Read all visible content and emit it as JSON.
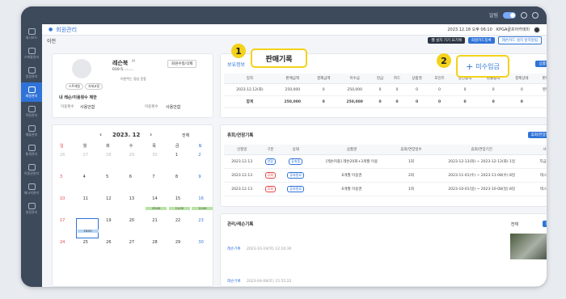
{
  "app": {
    "logo": "",
    "top_status": "알림"
  },
  "header": {
    "title": "회원관리",
    "datetime": "2023.12.18 오후 06:10",
    "center": "KPGA골프아카데미"
  },
  "subheader": {
    "back": "이전",
    "btn_1": "웹 설치 기기 요기에",
    "btn_2": "회원카드등록",
    "btn_3": "레슨카드 설치 방지알림"
  },
  "sidebar": {
    "items": [
      {
        "label": "대시보드"
      },
      {
        "label": "스케줄관리"
      },
      {
        "label": "일정관리"
      },
      {
        "label": "회원관리"
      },
      {
        "label": "직원관리"
      },
      {
        "label": "매출관리"
      },
      {
        "label": "통계관리"
      },
      {
        "label": "이용권관리"
      },
      {
        "label": "메시지관리"
      },
      {
        "label": "설정관리"
      }
    ]
  },
  "profile": {
    "name": "레슨북",
    "tag": "M",
    "phone": "010-5...-.....",
    "btn_register": "회원수정/삭제",
    "memo": "이번주는 정상 운동",
    "badge_1": "스트레칭",
    "badge_2": "자세교정",
    "section_title": "내 레슨/이용횟수 제한",
    "field_1_label": "이용횟수",
    "field_1_value": "사용안함",
    "field_2_label": "이용횟수",
    "field_2_value": "사용안함"
  },
  "sales": {
    "tab": "보유정보",
    "add_btn": "상품등록",
    "columns": [
      "일자",
      "판매금액",
      "결제금액",
      "미수금",
      "현금",
      "카드",
      "상품권",
      "포인트",
      "할인금액",
      "환불금액",
      "결제상태",
      "판매자"
    ],
    "rows": [
      [
        "2023.12.12(화)",
        "250,000",
        "0",
        "250,000",
        "0",
        "0",
        "0",
        "0",
        "0",
        "0",
        "0",
        "영업주"
      ],
      [
        "합계",
        "250,000",
        "0",
        "250,000",
        "0",
        "0",
        "0",
        "0",
        "0",
        "0",
        "0",
        ""
      ]
    ]
  },
  "callouts": {
    "one_num": "1",
    "one_label": "판매기록",
    "two_num": "2",
    "two_label": "미수입금"
  },
  "lesson": {
    "title": "휴회/연장기록",
    "add_btn": "휴회/연장등록",
    "columns": [
      "신청일",
      "구분",
      "상태",
      "상품명",
      "휴회/연장일수",
      "휴회/연장기간",
      "사유"
    ],
    "rows": [
      [
        "2023.12.13",
        "연장",
        "휴회중",
        "[레슨커플] 레슨20회+3개월 이용",
        "1회",
        "2023-12-13(화) ~ 2023-12-12(화)",
        "1일",
        "지금사용"
      ],
      [
        "2023.12.13",
        "휴회",
        "휴회종료",
        "6개월 이용권",
        "2회",
        "2023-11-01(수) ~ 2023-11-08(수)",
        "8일",
        "테스트2"
      ],
      [
        "2023.12.13",
        "휴회",
        "휴회종료",
        "6개월 이용권",
        "1회",
        "2023-10-01(일) ~ 2023-10-08(일)",
        "8일",
        "테스트1"
      ]
    ]
  },
  "records": {
    "title": "관리/레슨기록",
    "filter": "전체",
    "add_btn": "등록",
    "item_1_type": "레슨기록",
    "item_1_date": "2023-10-19(목) 12:10:30",
    "item_2_type": "레슨기록",
    "item_2_date": "2023-04-08(토) 15:55:22"
  },
  "calendar": {
    "month": "2023. 12",
    "filter": "전체",
    "weekdays": [
      "일",
      "월",
      "화",
      "수",
      "목",
      "금",
      "토"
    ],
    "days": [
      "26",
      "27",
      "28",
      "29",
      "30",
      "1",
      "2",
      "3",
      "4",
      "5",
      "6",
      "7",
      "8",
      "9",
      "10",
      "11",
      "12",
      "13",
      "14",
      "15",
      "16",
      "17",
      "18",
      "19",
      "20",
      "21",
      "22",
      "23",
      "24",
      "25",
      "26",
      "27",
      "28",
      "29",
      "30"
    ],
    "bar_1": "05:00",
    "bar_2": "11:00",
    "bar_3": "12:00",
    "bar_4": "18:00"
  },
  "colors": {
    "accent": "#2f73d8",
    "callout": "#f3d21b",
    "sidebar": "#3d4a5c"
  }
}
